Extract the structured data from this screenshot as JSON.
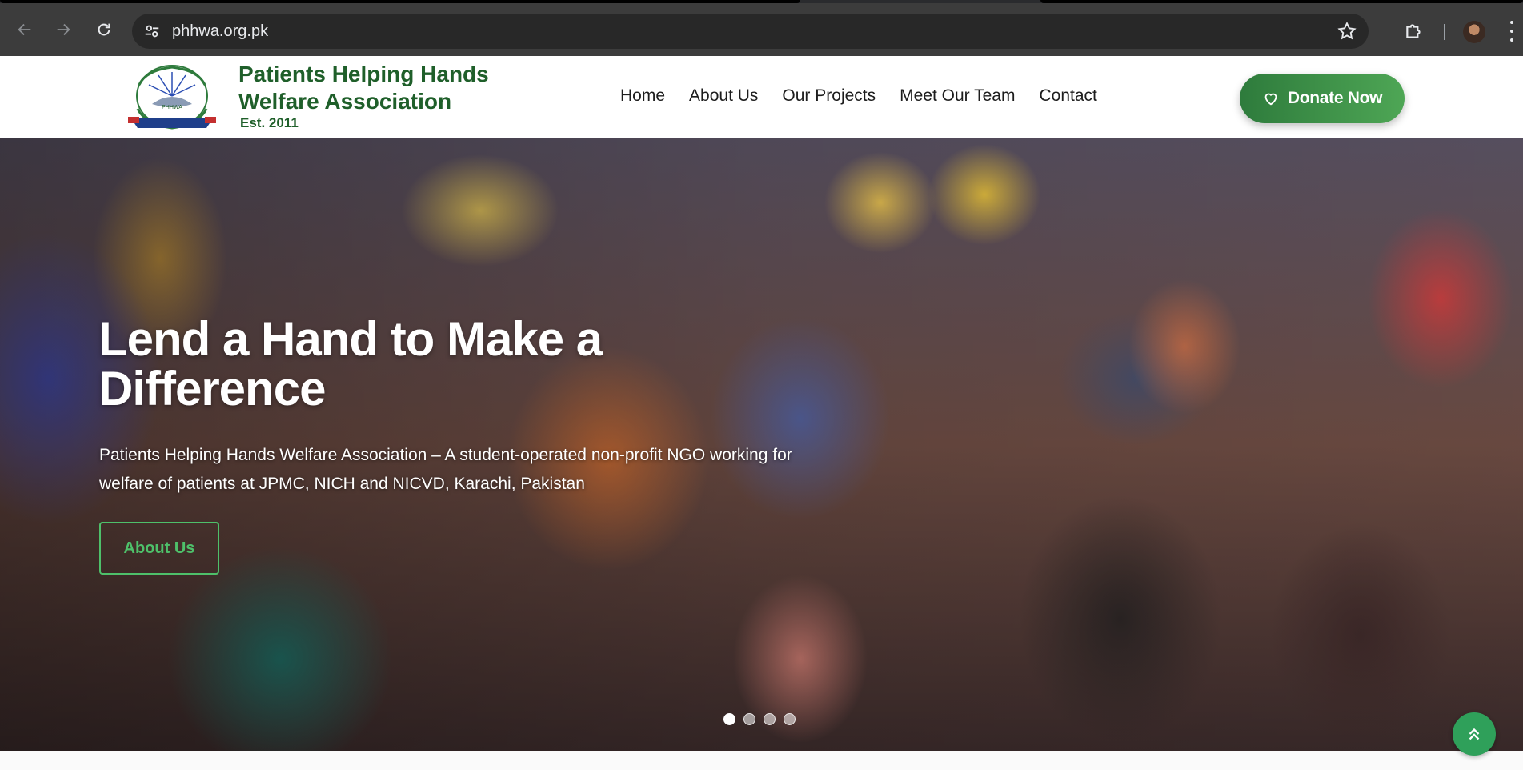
{
  "browser": {
    "url": "phhwa.org.pk",
    "icons": {
      "back": "arrow-left-icon",
      "forward": "arrow-right-icon",
      "reload": "reload-icon",
      "site_info": "tune-icon",
      "bookmark": "star-icon",
      "extensions": "puzzle-icon",
      "menu": "kebab-menu-icon"
    }
  },
  "header": {
    "brand_title": "Patients Helping Hands Welfare Association",
    "brand_est": "Est. 2011",
    "nav": [
      {
        "label": "Home"
      },
      {
        "label": "About Us"
      },
      {
        "label": "Our Projects"
      },
      {
        "label": "Meet Our Team"
      },
      {
        "label": "Contact"
      }
    ],
    "donate_label": "Donate Now",
    "accent_color": "#1f5f2a"
  },
  "hero": {
    "title": "Lend a Hand to Make a Difference",
    "subtitle": "Patients Helping Hands Welfare Association – A student-operated non-profit NGO working for welfare of patients at JPMC, NICH and NICVD, Karachi, Pakistan",
    "button_label": "About Us",
    "button_color": "#4ec06a",
    "slides_count": 4,
    "active_slide": 1
  },
  "back_to_top": {
    "icon": "double-chevron-up-icon",
    "color": "#2fa05a"
  }
}
